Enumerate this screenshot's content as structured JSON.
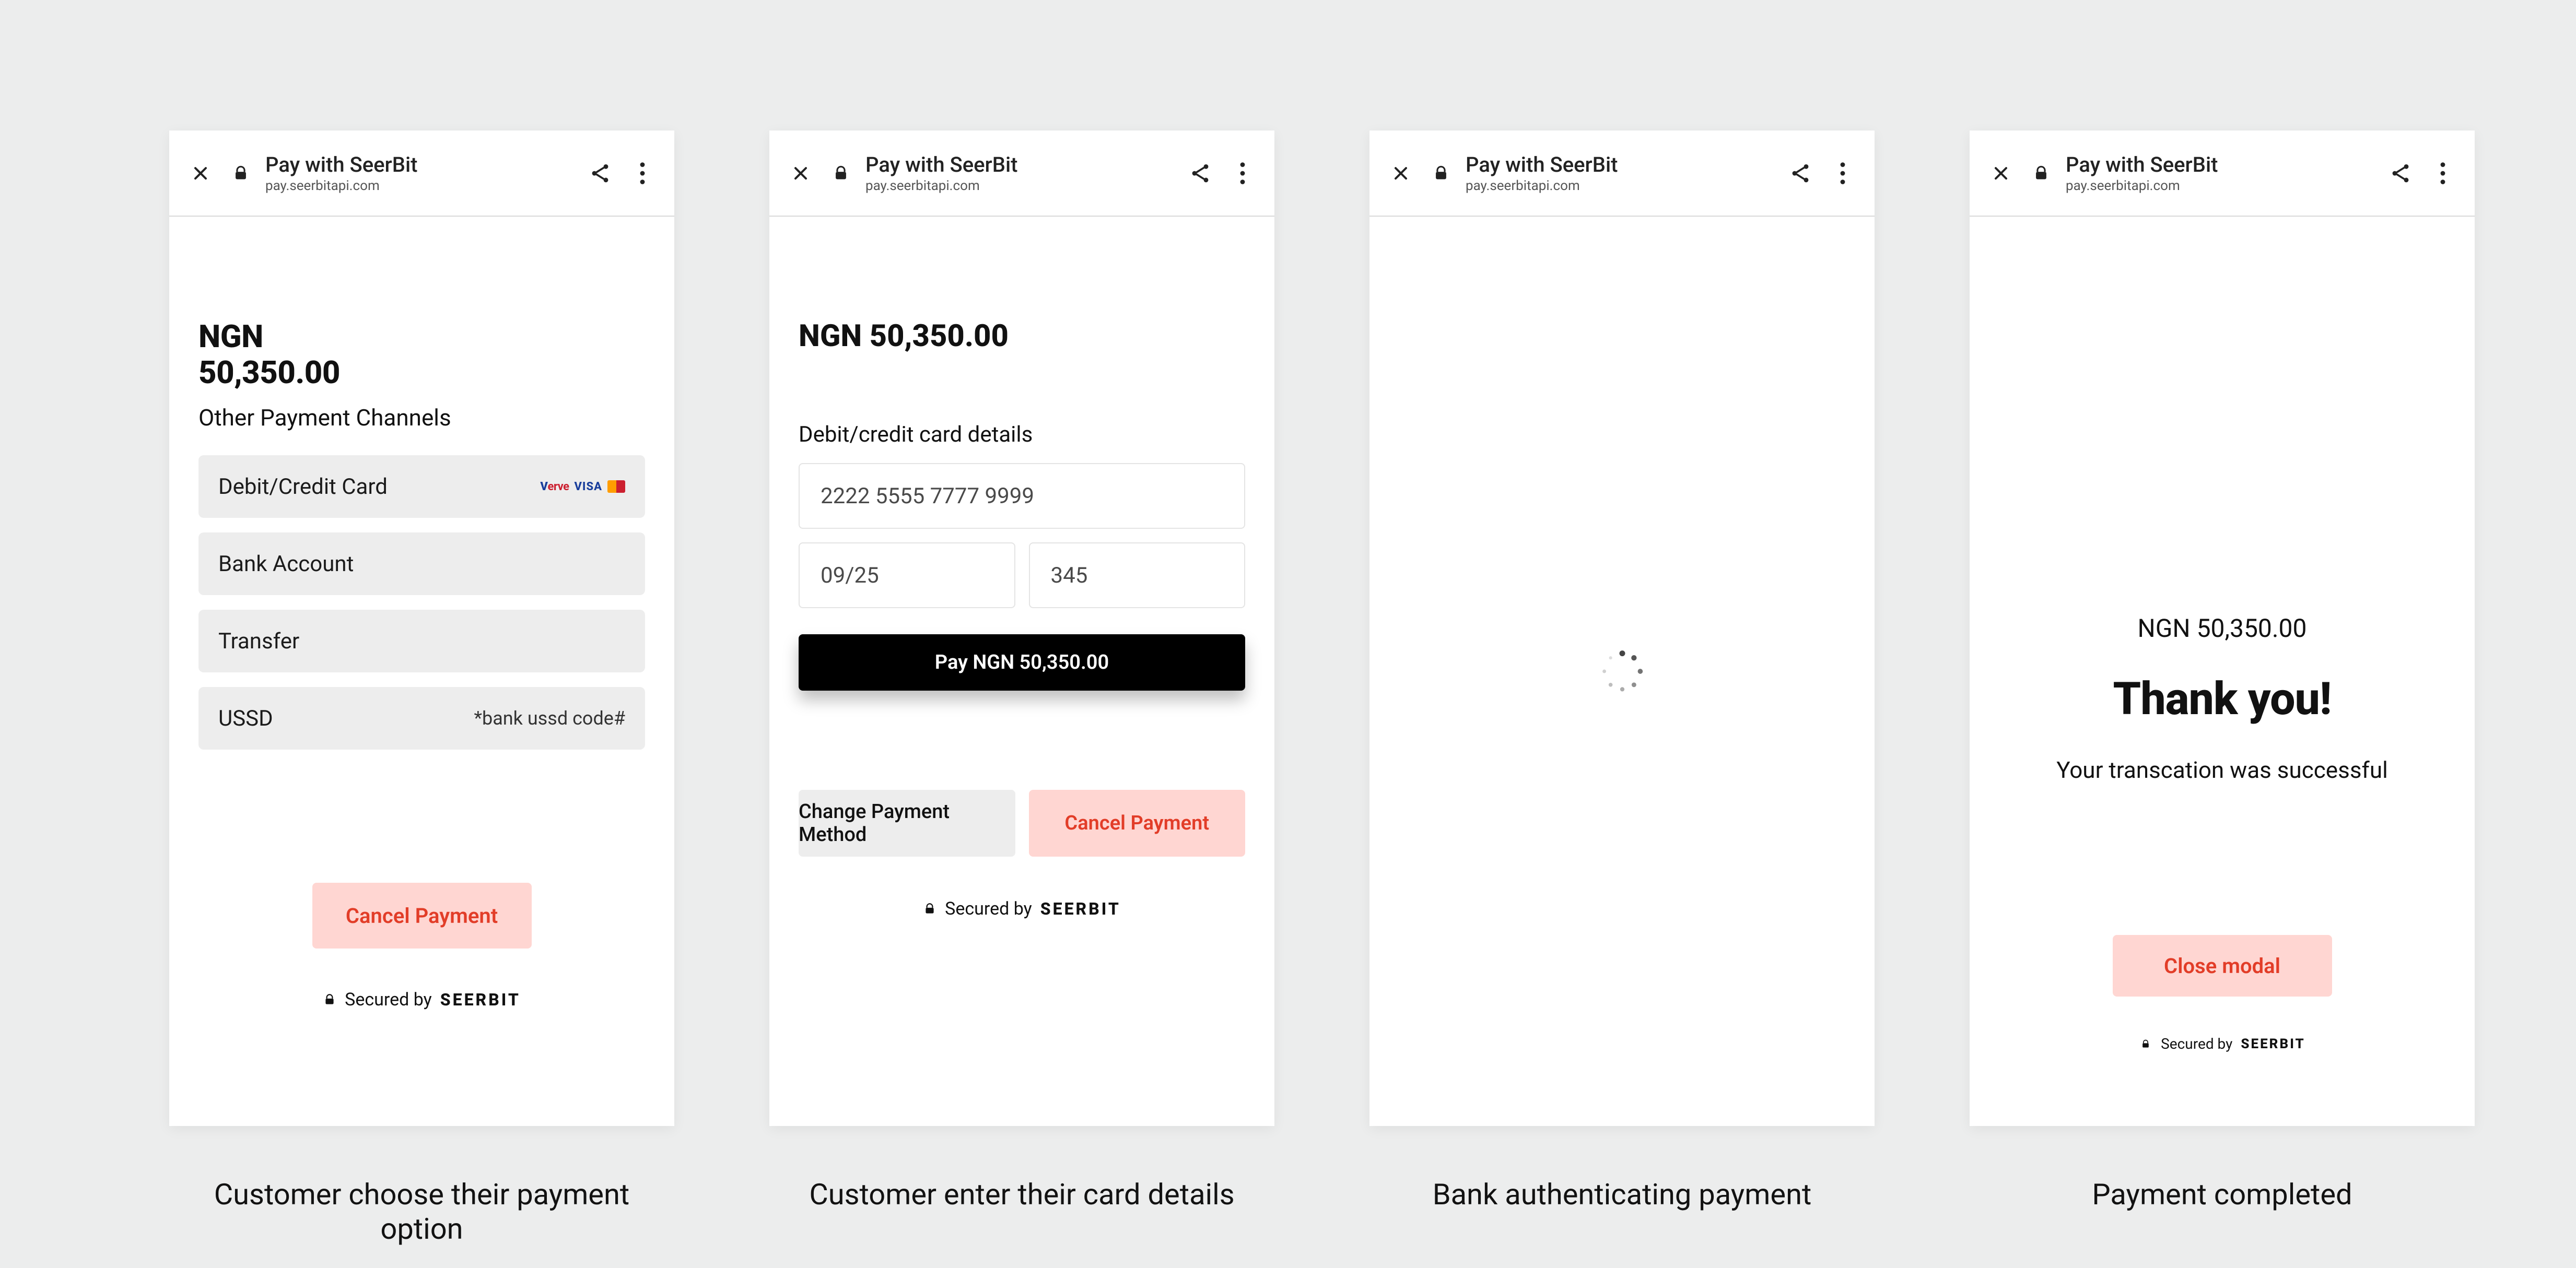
{
  "toolbar": {
    "title": "Pay with SeerBit",
    "url": "pay.seerbitapi.com"
  },
  "securedBy": {
    "prefix": "Secured by",
    "brand": "SEERBIT"
  },
  "captions": {
    "s1": "Customer choose their payment option",
    "s2": "Customer enter their card details",
    "s3": "Bank authenticating payment",
    "s4": "Payment completed"
  },
  "screen1": {
    "currency": "NGN",
    "amount": "50,350.00",
    "subheading": "Other Payment Channels",
    "channels": {
      "card": {
        "label": "Debit/Credit Card"
      },
      "bank": {
        "label": "Bank Account"
      },
      "transfer": {
        "label": "Transfer"
      },
      "ussd": {
        "label": "USSD",
        "hint": "*bank ussd code#"
      }
    },
    "cancel": "Cancel Payment"
  },
  "screen2": {
    "amount": "NGN 50,350.00",
    "formLabel": "Debit/credit card details",
    "cardNumber": "2222 5555 7777 9999",
    "expiry": "09/25",
    "cvv": "345",
    "payLabel": "Pay NGN 50,350.00",
    "changeMethod": "Change Payment Method",
    "cancel": "Cancel Payment"
  },
  "screen4": {
    "amount": "NGN  50,350.00",
    "thankYou": "Thank you!",
    "message": "Your transcation was successful",
    "close": "Close modal"
  }
}
